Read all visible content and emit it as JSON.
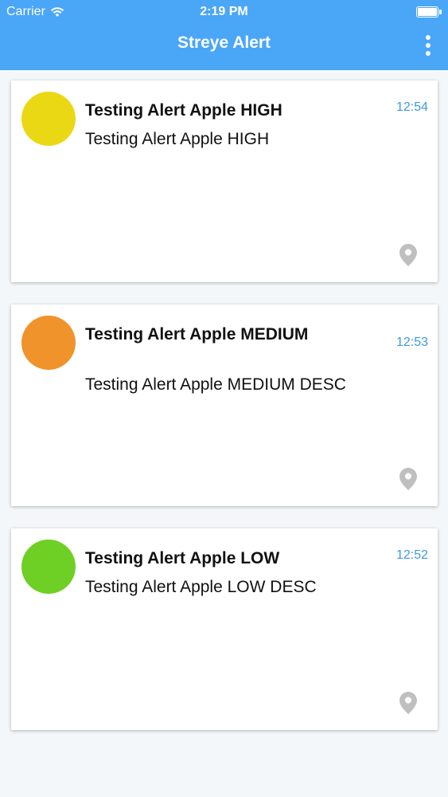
{
  "status_bar": {
    "carrier": "Carrier",
    "time": "2:19 PM",
    "wifi_icon": "wifi-icon",
    "battery_icon": "battery-icon"
  },
  "header": {
    "title": "Streye Alert",
    "menu_icon": "more-vertical-icon",
    "background_color": "#4aa6f7"
  },
  "alerts": [
    {
      "title": "Testing Alert Apple HIGH",
      "description": "Testing Alert Apple HIGH",
      "time": "12:54",
      "severity_color": "#ead814",
      "location_icon": "location-pin-icon"
    },
    {
      "title": "Testing Alert Apple MEDIUM",
      "description": "Testing Alert Apple MEDIUM DESC",
      "time": "12:53",
      "severity_color": "#f0932a",
      "location_icon": "location-pin-icon"
    },
    {
      "title": "Testing Alert Apple LOW",
      "description": "Testing Alert Apple LOW DESC",
      "time": "12:52",
      "severity_color": "#6ecf24",
      "location_icon": "location-pin-icon"
    }
  ]
}
